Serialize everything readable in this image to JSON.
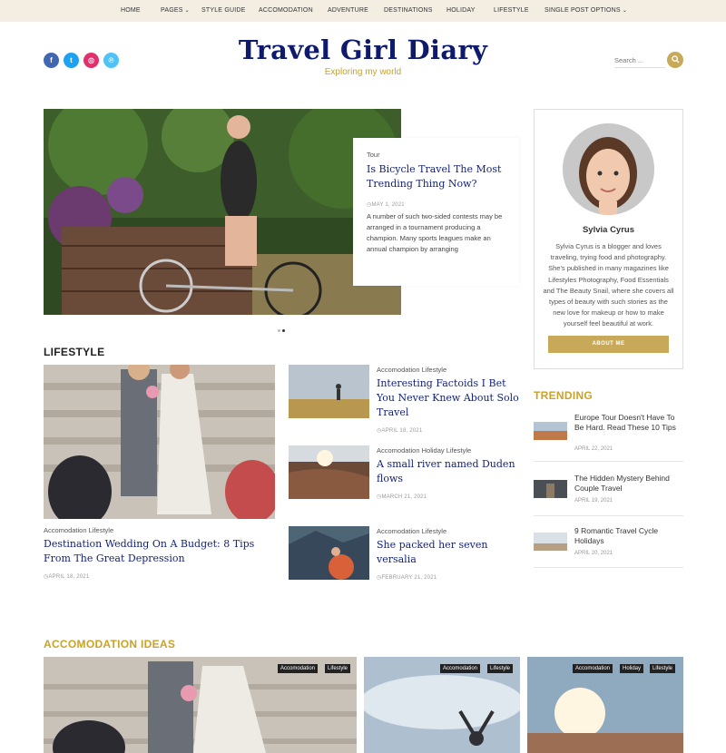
{
  "nav": {
    "items": [
      {
        "label": "HOME",
        "caret": ""
      },
      {
        "label": "PAGES",
        "caret": "⌄"
      },
      {
        "label": "STYLE GUIDE",
        "caret": ""
      },
      {
        "label": "ACCOMODATION",
        "caret": ""
      },
      {
        "label": "ADVENTURE",
        "caret": ""
      },
      {
        "label": "DESTINATIONS",
        "caret": ""
      },
      {
        "label": "HOLIDAY",
        "caret": ""
      },
      {
        "label": "LIFESTYLE",
        "caret": ""
      },
      {
        "label": "SINGLE POST OPTIONS",
        "caret": "⌄"
      }
    ]
  },
  "header": {
    "title": "Travel Girl Diary",
    "tagline": "Exploring my world",
    "social": [
      {
        "icon": "facebook-icon",
        "glyph": "f",
        "color": "#4267b2"
      },
      {
        "icon": "twitter-icon",
        "glyph": "t",
        "color": "#1da1f2"
      },
      {
        "icon": "instagram-icon",
        "glyph": "◎",
        "color": "#e1306c"
      },
      {
        "icon": "pinterest-icon",
        "glyph": "℗",
        "color": "#4fc3f7"
      }
    ],
    "search_placeholder": "Search ...",
    "accent": "#c8a95a",
    "title_color": "#0e1a6b"
  },
  "hero": {
    "category": "Tour",
    "title": "Is Bicycle Travel The Most Trending Thing Now?",
    "date": "MAY 1, 2021",
    "excerpt": "A number of such two-sided contests may be arranged in a tournament producing a champion. Many sports leagues make an annual champion by arranging"
  },
  "lifestyle": {
    "heading": "LIFESTYLE",
    "featured": {
      "categories": "Accomodation  Lifestyle",
      "title": "Destination Wedding On A Budget: 8 Tips From The Great Depression",
      "date": "APRIL 18, 2021"
    },
    "posts": [
      {
        "categories": "Accomodation  Lifestyle",
        "title": "Interesting Factoids I Bet You Never Knew About Solo Travel",
        "date": "APRIL 18, 2021"
      },
      {
        "categories": "Accomodation  Holiday  Lifestyle",
        "title": "A small river named Duden flows",
        "date": "MARCH 21, 2021"
      },
      {
        "categories": "Accomodation  Lifestyle",
        "title": "She packed her seven versalia",
        "date": "FEBRUARY 21, 2021"
      }
    ]
  },
  "author": {
    "name": "Sylvia Cyrus",
    "bio": "Sylvia Cyrus is a blogger and loves traveling, trying food and photography. She's published in many magazines like Lifestyles Photography, Food Essentials and The Beauty Snail, where she covers all types of beauty with such stories as the new love for makeup or how to make yourself feel beautiful at work.",
    "button": "ABOUT ME"
  },
  "trending": {
    "heading": "TRENDING",
    "items": [
      {
        "title": "Europe Tour Doesn't Have To Be Hard. Read These 10 Tips",
        "date": "APRIL 22, 2021"
      },
      {
        "title": "The Hidden Mystery Behind Couple Travel",
        "date": "APRIL 19, 2021"
      },
      {
        "title": "9 Romantic Travel Cycle Holidays",
        "date": "APRIL 20, 2021"
      }
    ]
  },
  "accomodation": {
    "heading": "ACCOMODATION IDEAS",
    "cards": [
      {
        "tags": [
          "Accomodation",
          "Lifestyle"
        ]
      },
      {
        "tags": [
          "Accomodation",
          "Lifestyle"
        ]
      },
      {
        "tags": [
          "Accomodation",
          "Holiday",
          "Lifestyle"
        ]
      }
    ]
  }
}
